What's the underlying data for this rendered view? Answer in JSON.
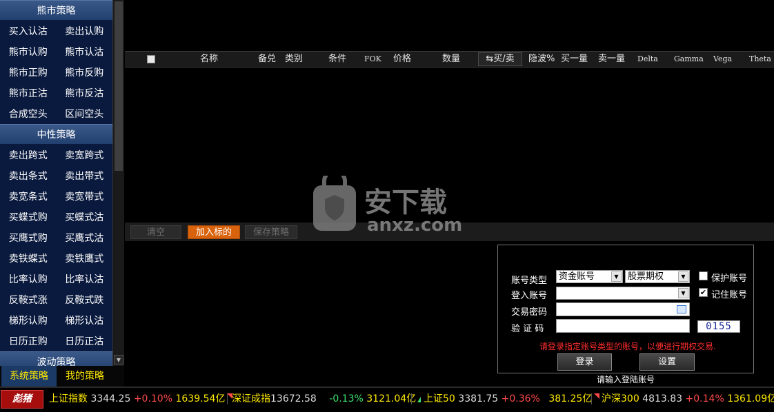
{
  "sidebar": {
    "sections": [
      {
        "title": "熊市策略",
        "items": [
          [
            "买入认沽",
            "卖出认购"
          ],
          [
            "熊市认购",
            "熊市认沽"
          ],
          [
            "熊市正购",
            "熊市反购"
          ],
          [
            "熊市正沽",
            "熊市反沽"
          ],
          [
            "合成空头",
            "区间空头"
          ]
        ]
      },
      {
        "title": "中性策略",
        "items": [
          [
            "卖出跨式",
            "卖宽跨式"
          ],
          [
            "卖出条式",
            "卖出带式"
          ],
          [
            "卖宽条式",
            "卖宽带式"
          ],
          [
            "买蝶式购",
            "买蝶式沽"
          ],
          [
            "买鹰式购",
            "买鹰式沽"
          ],
          [
            "卖铁蝶式",
            "卖铁鹰式"
          ],
          [
            "比率认购",
            "比率认沽"
          ],
          [
            "反鞍式涨",
            "反鞍式跌"
          ],
          [
            "梯形认购",
            "梯形认沽"
          ],
          [
            "日历正购",
            "日历正沽"
          ]
        ]
      },
      {
        "title": "波动策略",
        "items": []
      }
    ],
    "tabs": [
      "系统策略",
      "我的策略"
    ]
  },
  "table": {
    "headers": [
      "名称",
      "备兑",
      "类别",
      "条件",
      "FOK",
      "价格",
      "数量",
      "买/卖",
      "隐波%",
      "买一量",
      "卖一量",
      "Delta",
      "Gamma",
      "Vega",
      "Theta"
    ],
    "buysell_icon": "swap-arrows-icon"
  },
  "actions": {
    "clear": "清空",
    "add": "加入标的",
    "save": "保存策略"
  },
  "login": {
    "account_type_label": "账号类型",
    "account_type_value": "资金账号",
    "market_value": "股票期权",
    "account_label": "登入账号",
    "account_value": "",
    "password_label": "交易密码",
    "captcha_label": "验 证 码",
    "captcha_value": "0155",
    "protect_label": "保护账号",
    "protect_checked": false,
    "remember_label": "记住账号",
    "remember_checked": true,
    "hint": "请登录指定账号类型的账号，以便进行期权交易.",
    "login_btn": "登录",
    "settings_btn": "设置",
    "status": "请输入登陆账号"
  },
  "watermark": {
    "cn": "安下载",
    "en": "anxz.com"
  },
  "ticker": {
    "logo": "彪猪",
    "items": [
      {
        "name": "上证指数",
        "price": "3344.25",
        "change": "+0.10%",
        "amount": "1639.54亿",
        "dir": "up"
      },
      {
        "name": "深证成指",
        "price": "13672.58",
        "change": "-0.13%",
        "amount": "3121.04亿",
        "dir": "down"
      },
      {
        "name": "上证50",
        "price": "3381.75",
        "change": "+0.36%",
        "amount": "381.25亿",
        "dir": "up"
      },
      {
        "name": "沪深300",
        "price": "4813.83",
        "change": "+0.14%",
        "amount": "1361.09亿",
        "dir": "up"
      }
    ]
  },
  "colors": {
    "sidebar_bg": "#0a1a3e",
    "header_grad": "#3a5888",
    "accent_orange": "#d9620c",
    "up": "#ff4a4a",
    "down": "#3ee06b",
    "yellow": "#ffea00"
  }
}
